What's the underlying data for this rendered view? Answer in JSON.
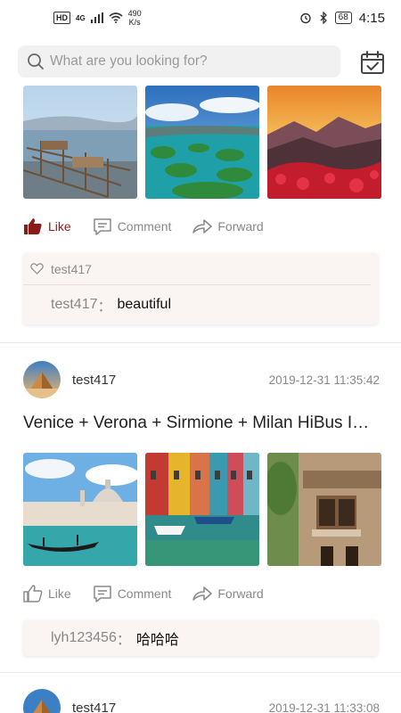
{
  "status_bar": {
    "network_badge": "HD",
    "signal_label": "4G",
    "speed_value": "490",
    "speed_unit": "K/s",
    "battery": "68",
    "time": "4:15"
  },
  "search": {
    "placeholder": "What are you looking for?"
  },
  "icons": {
    "search": "search-icon",
    "calendar": "calendar-check-icon",
    "like": "thumbs-up-icon",
    "comment": "comment-icon",
    "forward": "forward-icon",
    "heart": "heart-icon"
  },
  "colors": {
    "liked": "#8a1b1b",
    "muted": "#888888",
    "comment_bg": "#faf4f3"
  },
  "actions": {
    "like": "Like",
    "comment": "Comment",
    "forward": "Forward"
  },
  "posts": [
    {
      "liked": true,
      "likers": "test417",
      "comments": [
        {
          "user": "test417",
          "sep": "：",
          "text": "beautiful"
        }
      ]
    },
    {
      "username": "test417",
      "time": "2019-12-31 11:35:42",
      "title": "Venice + Verona + Sirmione + Milan HiBus Int...",
      "liked": false,
      "comments": [
        {
          "user": "lyh123456",
          "sep": "：",
          "text": "哈哈哈"
        }
      ]
    },
    {
      "username": "test417",
      "time": "2019-12-31 11:33:08"
    }
  ]
}
